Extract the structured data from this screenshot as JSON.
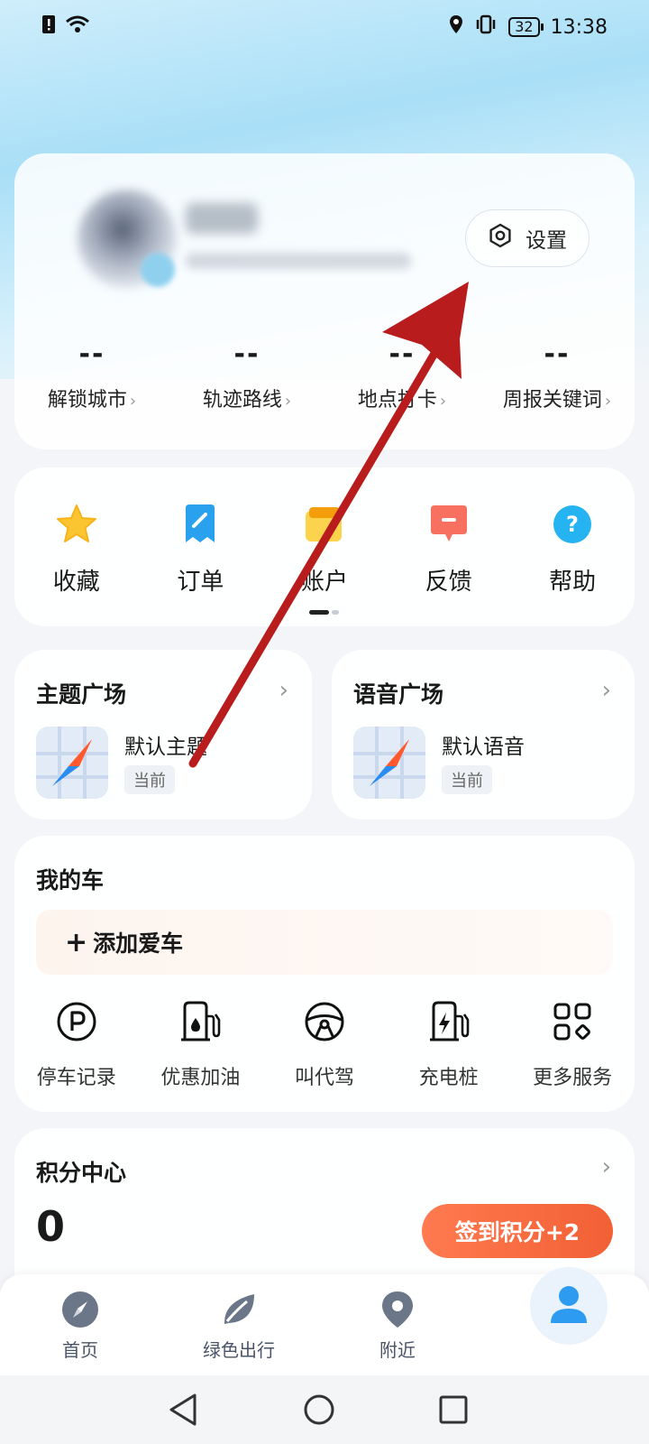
{
  "status_bar": {
    "time": "13:38",
    "battery": "32"
  },
  "profile": {
    "settings_label": "设置",
    "stats": [
      {
        "value": "--",
        "label": "解锁城市"
      },
      {
        "value": "--",
        "label": "轨迹路线"
      },
      {
        "value": "--",
        "label": "地点打卡"
      },
      {
        "value": "--",
        "label": "周报关键词"
      }
    ]
  },
  "shortcuts": [
    {
      "label": "收藏",
      "icon": "star-icon"
    },
    {
      "label": "订单",
      "icon": "order-icon"
    },
    {
      "label": "账户",
      "icon": "wallet-icon"
    },
    {
      "label": "反馈",
      "icon": "feedback-icon"
    },
    {
      "label": "帮助",
      "icon": "help-icon"
    }
  ],
  "theme_plaza": {
    "title": "主题广场",
    "name": "默认主题",
    "tag": "当前"
  },
  "voice_plaza": {
    "title": "语音广场",
    "name": "默认语音",
    "tag": "当前"
  },
  "my_car": {
    "title": "我的车",
    "add_label": "添加爱车",
    "services": [
      {
        "label": "停车记录",
        "icon": "parking-icon"
      },
      {
        "label": "优惠加油",
        "icon": "fuel-icon"
      },
      {
        "label": "叫代驾",
        "icon": "steering-wheel-icon"
      },
      {
        "label": "充电桩",
        "icon": "charging-icon"
      },
      {
        "label": "更多服务",
        "icon": "grid-icon"
      }
    ]
  },
  "points": {
    "title": "积分中心",
    "value": "0",
    "checkin_label": "签到积分+2"
  },
  "bottom_nav": [
    {
      "label": "首页",
      "icon": "compass-icon"
    },
    {
      "label": "绿色出行",
      "icon": "leaf-icon"
    },
    {
      "label": "附近",
      "icon": "location-pin-icon"
    },
    {
      "label": "",
      "icon": "user-icon"
    }
  ],
  "colors": {
    "accent": "#f26035",
    "arrow": "#b81c1c",
    "nav_icon": "#6b7789",
    "me_icon": "#2d9cf0"
  }
}
